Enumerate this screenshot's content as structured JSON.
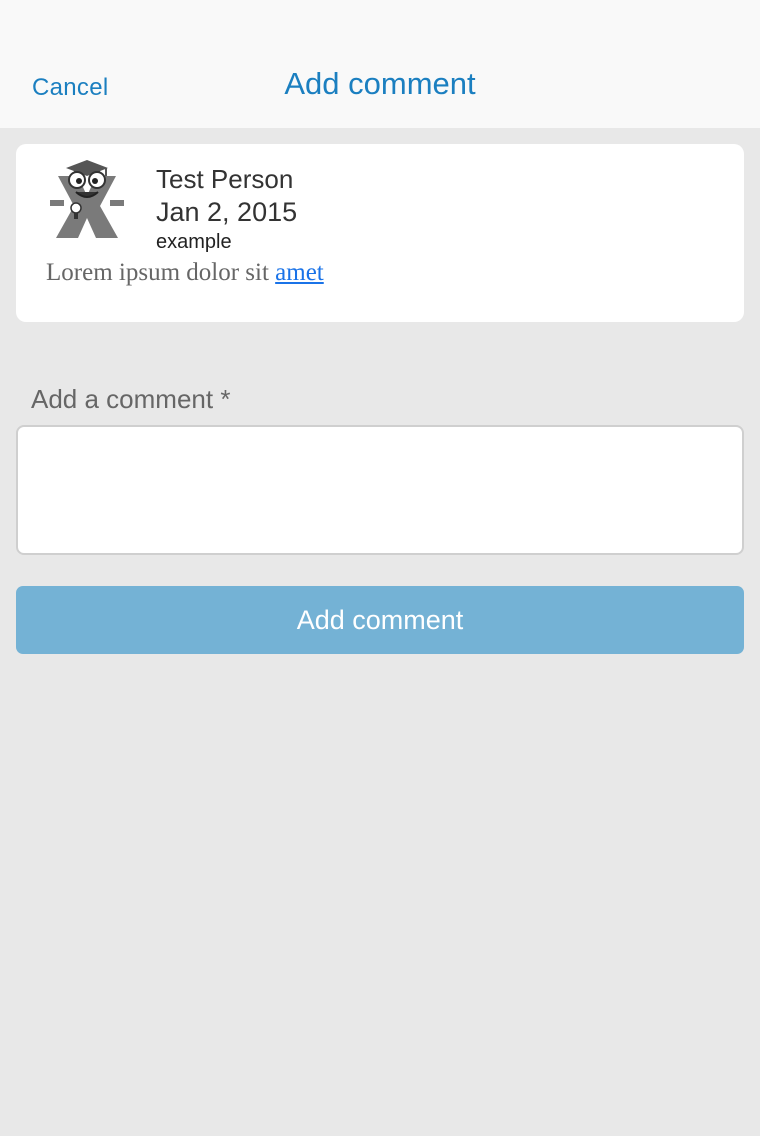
{
  "header": {
    "cancel_label": "Cancel",
    "title": "Add comment"
  },
  "comment": {
    "author": "Test Person",
    "date": "Jan 2, 2015",
    "username": "example",
    "body_text": "Lorem ipsum dolor sit",
    "body_link": "amet",
    "avatar_icon": "graduate-mascot-avatar-icon"
  },
  "form": {
    "field_label": "Add a comment *",
    "comment_value": "",
    "submit_label": "Add comment"
  },
  "colors": {
    "accent": "#1b7fc0",
    "button": "#74b2d5",
    "background": "#e8e8e8",
    "link": "#1a73e8"
  }
}
